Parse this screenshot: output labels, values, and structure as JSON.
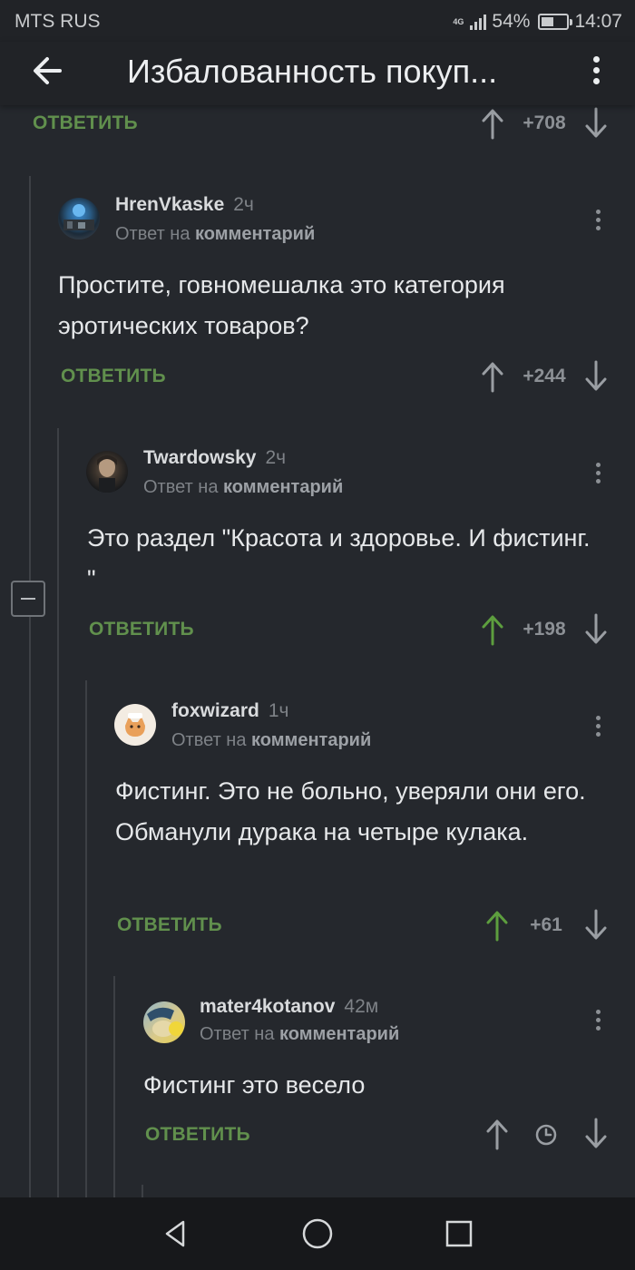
{
  "status_bar": {
    "carrier": "MTS RUS",
    "network": "4G",
    "battery_percent": "54%",
    "battery_level": 0.54,
    "time": "14:07",
    "icons": [
      "signal-icon",
      "battery-icon"
    ]
  },
  "header": {
    "title": "Избалованность покуп...",
    "back_icon": "back-arrow-icon",
    "menu_icon": "more-vert-icon"
  },
  "top_actions": {
    "reply_label": "ОТВЕТИТЬ",
    "score": "+708"
  },
  "comments": [
    {
      "author": "HrenVkaske",
      "time": "2ч",
      "reply_prefix": "Ответ на",
      "reply_target": "комментарий",
      "text": "Простите, говномешалка это категория эротических товаров?",
      "reply_label": "ОТВЕТИТЬ",
      "score": "+244",
      "upvoted": false
    },
    {
      "author": "Twardowsky",
      "time": "2ч",
      "reply_prefix": "Ответ на",
      "reply_target": "комментарий",
      "text": "Это раздел \"Красота и здоровье. И фистинг. \"",
      "reply_label": "ОТВЕТИТЬ",
      "score": "+198",
      "upvoted": true
    },
    {
      "author": "foxwizard",
      "time": "1ч",
      "reply_prefix": "Ответ на",
      "reply_target": "комментарий",
      "text": "Фистинг. Это не больно, уверяли они его. Обманули дурака на четыре кулака.",
      "reply_label": "ОТВЕТИТЬ",
      "score": "+61",
      "upvoted": true
    },
    {
      "author": "mater4kotanov",
      "time": "42м",
      "reply_prefix": "Ответ на",
      "reply_target": "комментарий",
      "text": "Фистинг это весело",
      "reply_label": "ОТВЕТИТЬ",
      "score_hidden_icon": "clock-icon",
      "upvoted": false
    }
  ],
  "colors": {
    "background": "#25282d",
    "header": "#212327",
    "accent_green": "#61904d",
    "upvote_active": "#5d9e3e",
    "muted": "#8c9095",
    "navbar": "#17181b"
  },
  "nav_bar": {
    "icons": [
      "nav-back-icon",
      "nav-home-icon",
      "nav-recents-icon"
    ]
  }
}
